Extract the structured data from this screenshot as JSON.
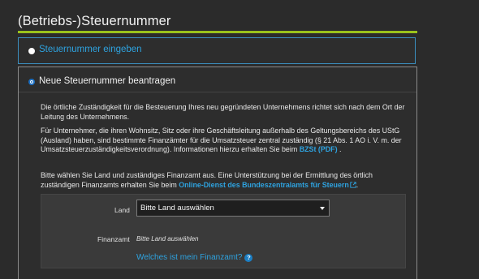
{
  "section": {
    "title": "(Betriebs-)Steuernummer"
  },
  "options": [
    {
      "label": "Steuernummer eingeben",
      "checked": false
    },
    {
      "label": "Neue Steuernummer beantragen",
      "checked": true
    }
  ],
  "info": {
    "p1": "Die örtliche Zuständigkeit für die Besteuerung Ihres neu gegründeten Unternehmens richtet sich nach dem Ort der Leitung des Unternehmens.",
    "p2_text": "Für Unternehmer, die ihren Wohnsitz, Sitz oder ihre Geschäftsleitung außerhalb des Geltungsbereichs des UStG (Ausland) haben, sind bestimmte Finanzämter für die Umsatzsteuer zentral zuständig (§ 21 Abs. 1 AO i. V. m. der Umsatzsteuerzuständigkeitsverordnung). Informationen hierzu erhalten Sie beim",
    "p2_link": "BZSt (PDF)",
    "p2_end": ".",
    "p3_text": "Bitte wählen Sie Land und zuständiges Finanzamt aus. Eine Unterstützung bei der Ermittlung des örtlich zuständigen Finanzamts erhalten Sie beim",
    "p3_link": "Online-Dienst des Bundeszentralamts für Steuern",
    "p3_end": "."
  },
  "form": {
    "land_label": "Land",
    "land_value": "Bitte Land auswählen",
    "finanzamt_label": "Finanzamt",
    "finanzamt_value": "Bitte Land auswählen",
    "help_link": "Welches ist mein Finanzamt?",
    "help_icon": "?"
  },
  "colors": {
    "accent_green": "#9bc21c",
    "link_blue": "#2ea3e0",
    "background": "#2b2b2b"
  },
  "icons": [
    "external-link-icon",
    "help-circle-icon",
    "chevron-down-icon"
  ]
}
